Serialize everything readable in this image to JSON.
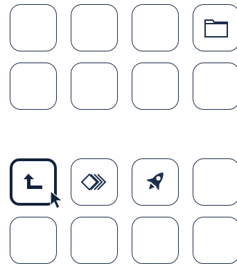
{
  "screen": {
    "accent_color": "#1d2f4a",
    "selected_border_color": "#13233d"
  },
  "grid_top": {
    "rows": [
      [
        {
          "name": "tile-empty",
          "icon": null
        },
        {
          "name": "tile-empty",
          "icon": null
        },
        {
          "name": "tile-empty",
          "icon": null
        },
        {
          "name": "tile-folder",
          "icon": "folder-icon"
        }
      ],
      [
        {
          "name": "tile-empty",
          "icon": null
        },
        {
          "name": "tile-empty",
          "icon": null
        },
        {
          "name": "tile-empty",
          "icon": null
        },
        {
          "name": "tile-empty",
          "icon": null
        }
      ]
    ]
  },
  "grid_bottom": {
    "rows": [
      [
        {
          "name": "tile-return",
          "icon": "return-arrow-icon",
          "selected": true
        },
        {
          "name": "tile-layers",
          "icon": "diamond-layers-icon"
        },
        {
          "name": "tile-rocket",
          "icon": "rocket-icon"
        },
        {
          "name": "tile-empty",
          "icon": null
        }
      ],
      [
        {
          "name": "tile-empty",
          "icon": null
        },
        {
          "name": "tile-empty",
          "icon": null
        },
        {
          "name": "tile-empty",
          "icon": null
        },
        {
          "name": "tile-empty",
          "icon": null
        }
      ]
    ]
  },
  "cursor": {
    "icon": "mouse-pointer-icon"
  }
}
